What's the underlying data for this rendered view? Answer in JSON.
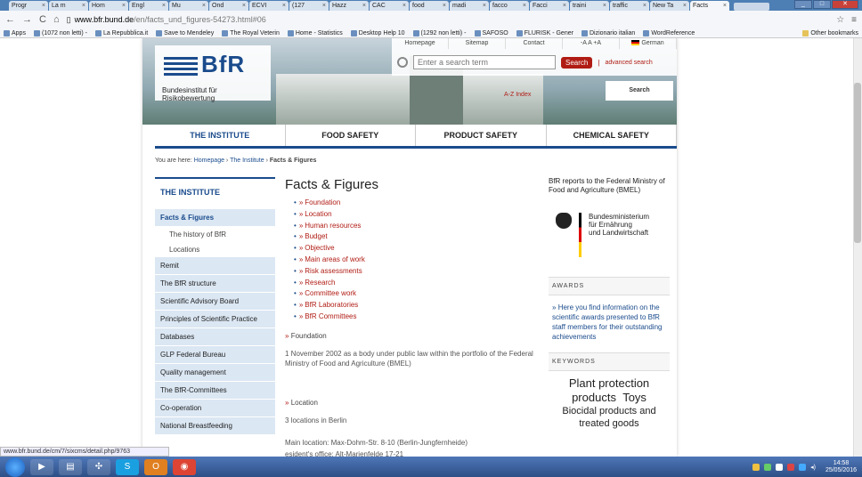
{
  "browser": {
    "tabs": [
      {
        "label": "Progr"
      },
      {
        "label": "La m"
      },
      {
        "label": "Hom"
      },
      {
        "label": "Engl"
      },
      {
        "label": "Mu"
      },
      {
        "label": "Ond"
      },
      {
        "label": "ECVI"
      },
      {
        "label": "(127"
      },
      {
        "label": "Hazz"
      },
      {
        "label": "CAC"
      },
      {
        "label": "food"
      },
      {
        "label": "madi"
      },
      {
        "label": "facco"
      },
      {
        "label": "Facci"
      },
      {
        "label": "traini"
      },
      {
        "label": "traffic"
      },
      {
        "label": "New Ta"
      },
      {
        "label": "Facts",
        "active": true
      }
    ],
    "url_host": "www.bfr.bund.de",
    "url_path": "/en/facts_und_figures-54273.html#06",
    "bookmarks": [
      "Apps",
      "(1072 non letti) -",
      "La Repubblica.it",
      "Save to Mendeley",
      "The Royal Veterin",
      "Home - Statistics",
      "Desktop Help 10",
      "(1292 non letti) -",
      "SAFOSO",
      "FLURISK - Gener",
      "Dizionario italian",
      "WordReference"
    ],
    "other_bookmarks": "Other bookmarks",
    "status_url": "www.bfr.bund.de/cm/7/sixcms/detail.php/9763"
  },
  "header": {
    "logo_text": "BfR",
    "logo_subtitle": "Bundesinstitut für Risikobewertung",
    "topnav": [
      "Homepage",
      "Sitemap",
      "Contact",
      "-A A +A",
      "German"
    ],
    "search_placeholder": "Enter a search term",
    "search_button": "Search",
    "advanced_search": "advanced search",
    "az_index": "A-Z Index",
    "az_search": "Search"
  },
  "mainnav": [
    "THE INSTITUTE",
    "FOOD SAFETY",
    "PRODUCT SAFETY",
    "CHEMICAL SAFETY"
  ],
  "breadcrumb": {
    "prefix": "You are here:",
    "items": [
      "Homepage",
      "The Institute"
    ],
    "current": "Facts & Figures"
  },
  "leftmenu": {
    "heading": "THE INSTITUTE",
    "selected": "Facts & Figures",
    "subitems": [
      "The history of BfR",
      "Locations"
    ],
    "items": [
      "Remit",
      "The BfR structure",
      "Scientific Advisory Board",
      "Principles of Scientific Practice",
      "Databases",
      "GLP Federal Bureau",
      "Quality management",
      "The BfR-Committees",
      "Co-operation",
      "National Breastfeeding"
    ]
  },
  "content": {
    "title": "Facts & Figures",
    "toc": [
      "Foundation",
      "Location",
      "Human resources",
      "Budget",
      "Objective",
      "Main areas of work",
      "Risk assessments",
      "Research",
      "Committee work",
      "BfR Laboratories",
      "BfR Committees"
    ],
    "sections": [
      {
        "heading": "Foundation",
        "text": "1 November 2002 as a body under public law within the portfolio of the Federal Ministry of Food and Agriculture (BMEL)"
      },
      {
        "heading": "Location",
        "text": "3 locations in Berlin"
      }
    ],
    "main_location": "Main location: Max-Dohm-Str. 8-10 (Berlin-Jungfernheide)",
    "president_office": "esident's office: Alt-Marienfelde 17-21"
  },
  "rightcol": {
    "intro": "BfR reports to the Federal Ministry of Food and Agriculture (BMEL)",
    "ministry": [
      "Bundesministerium",
      "für Ernährung",
      "und Landwirtschaft"
    ],
    "awards_heading": "AWARDS",
    "awards_text": "Here you find information on the scientific awards presented to BfR staff members for their outstanding achievements",
    "keywords_heading": "KEYWORDS",
    "keywords": [
      "Plant protection",
      "products",
      "Toys",
      "Biocidal products and",
      "treated goods"
    ]
  },
  "taskbar": {
    "time": "14:58",
    "date": "25/05/2016"
  }
}
